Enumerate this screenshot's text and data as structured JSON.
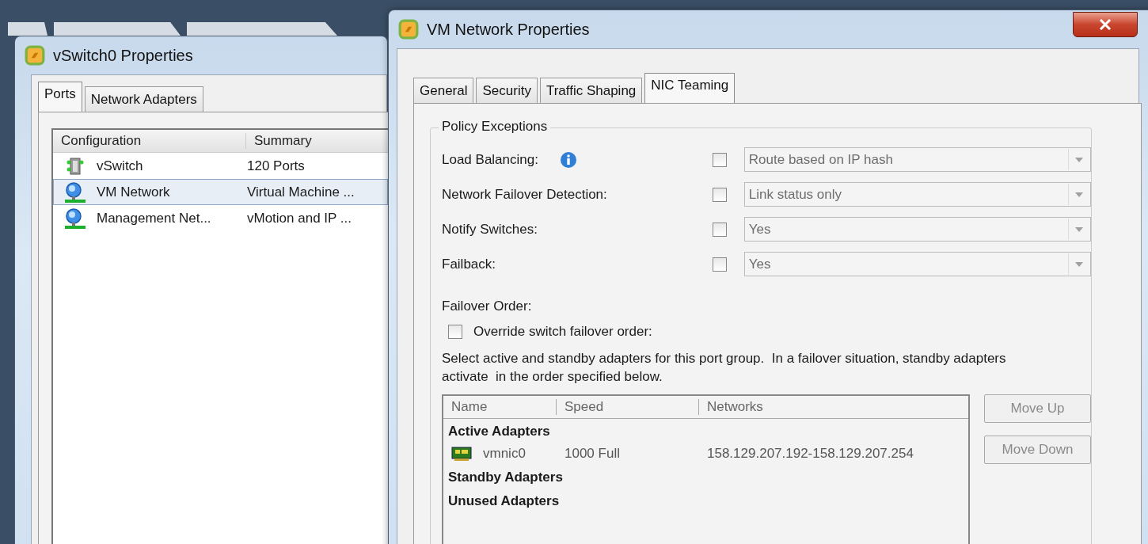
{
  "vswitch_window": {
    "title": "vSwitch0 Properties",
    "tabs": [
      {
        "label": "Ports",
        "selected": true
      },
      {
        "label": "Network Adapters",
        "selected": false
      }
    ],
    "columns": [
      "Configuration",
      "Summary"
    ],
    "rows": [
      {
        "kind": "switch",
        "configuration": "vSwitch",
        "summary": "120 Ports",
        "selected": false
      },
      {
        "kind": "network",
        "configuration": "VM Network",
        "summary": "Virtual Machine ...",
        "selected": true
      },
      {
        "kind": "network",
        "configuration": "Management Net...",
        "summary": "vMotion and IP ...",
        "selected": false
      }
    ]
  },
  "vm_window": {
    "title": "VM Network Properties",
    "tabs": [
      {
        "label": "General",
        "selected": false
      },
      {
        "label": "Security",
        "selected": false
      },
      {
        "label": "Traffic Shaping",
        "selected": false
      },
      {
        "label": "NIC Teaming",
        "selected": true
      }
    ],
    "group_title": "Policy Exceptions",
    "policies": [
      {
        "label": "Load Balancing:",
        "info": true,
        "checked": false,
        "value": "Route based on IP hash"
      },
      {
        "label": "Network Failover Detection:",
        "info": false,
        "checked": false,
        "value": "Link status only"
      },
      {
        "label": "Notify Switches:",
        "info": false,
        "checked": false,
        "value": "Yes"
      },
      {
        "label": "Failback:",
        "info": false,
        "checked": false,
        "value": "Yes"
      }
    ],
    "failover_order_label": "Failover Order:",
    "override": {
      "label": "Override switch failover order:",
      "checked": false
    },
    "description": "Select active and standby adapters for this port group.  In a failover situation, standby adapters activate  in the order specified below.",
    "adapter_columns": [
      "Name",
      "Speed",
      "Networks"
    ],
    "adapter_groups": [
      {
        "title": "Active Adapters",
        "adapters": [
          {
            "name": "vmnic0",
            "speed": "1000 Full",
            "networks": "158.129.207.192-158.129.207.254"
          }
        ]
      },
      {
        "title": "Standby Adapters"
      },
      {
        "title": "Unused Adapters"
      }
    ],
    "buttons": [
      {
        "label": "Move Up",
        "disabled": true
      },
      {
        "label": "Move Down",
        "disabled": true
      }
    ]
  }
}
